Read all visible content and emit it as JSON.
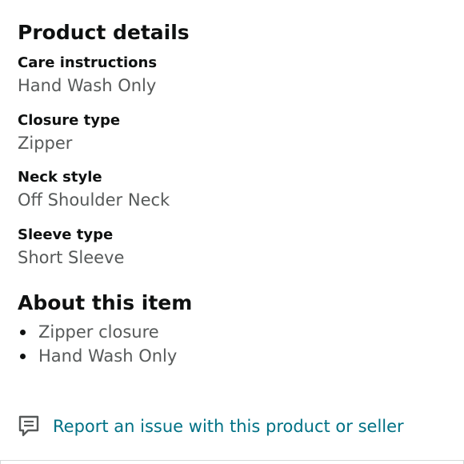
{
  "product_details": {
    "title": "Product details",
    "items": [
      {
        "label": "Care instructions",
        "value": "Hand Wash Only"
      },
      {
        "label": "Closure type",
        "value": "Zipper"
      },
      {
        "label": "Neck style",
        "value": "Off Shoulder Neck"
      },
      {
        "label": "Sleeve type",
        "value": "Short Sleeve"
      }
    ]
  },
  "about": {
    "title": "About this item",
    "bullets": [
      "Zipper closure",
      "Hand Wash Only"
    ]
  },
  "report": {
    "icon": "feedback-speech-bubble-icon",
    "label": "Report an issue with this product or seller",
    "color": "#007185"
  },
  "colors": {
    "heading": "#0f1111",
    "value_text": "#565959",
    "link": "#007185"
  }
}
